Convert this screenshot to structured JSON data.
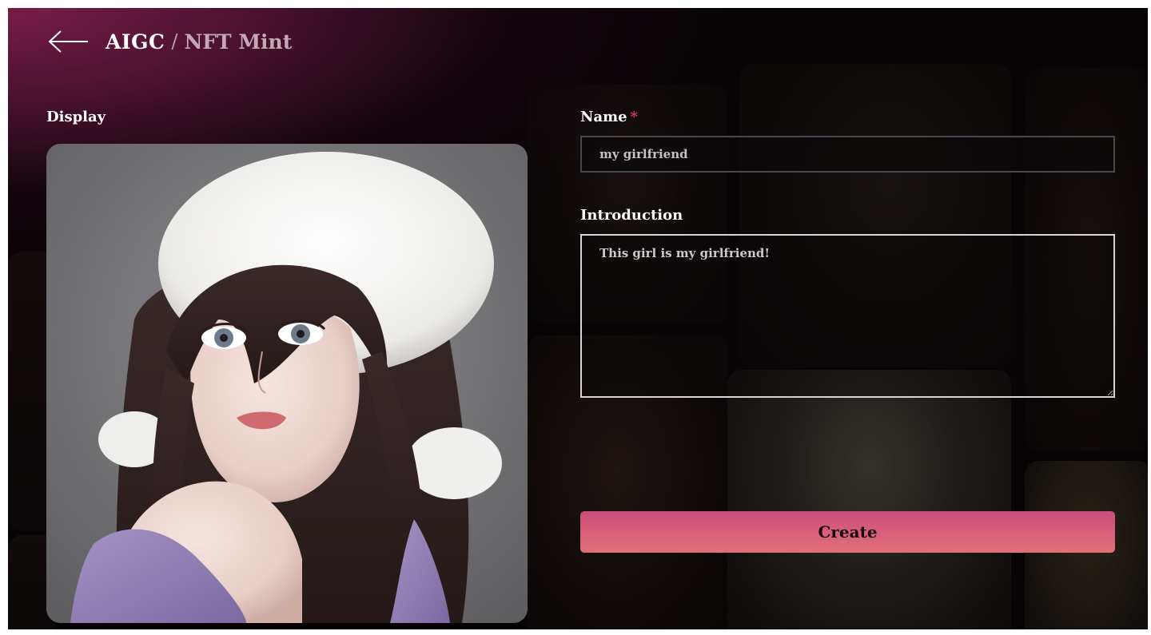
{
  "header": {
    "back_icon": "arrow-left-icon",
    "breadcrumb_root": "AIGC",
    "breadcrumb_separator": "/",
    "breadcrumb_current": "NFT Mint"
  },
  "display": {
    "label": "Display"
  },
  "form": {
    "name_label": "Name",
    "name_required_mark": "*",
    "name_value": "my girlfriend",
    "introduction_label": "Introduction",
    "introduction_value": "This girl is my girlfriend!",
    "create_label": "Create"
  },
  "colors": {
    "accent_gradient_start": "#c94f7d",
    "accent_gradient_end": "#e07075",
    "header_glow": "#7d1e4b",
    "required_mark": "#d0435f"
  }
}
